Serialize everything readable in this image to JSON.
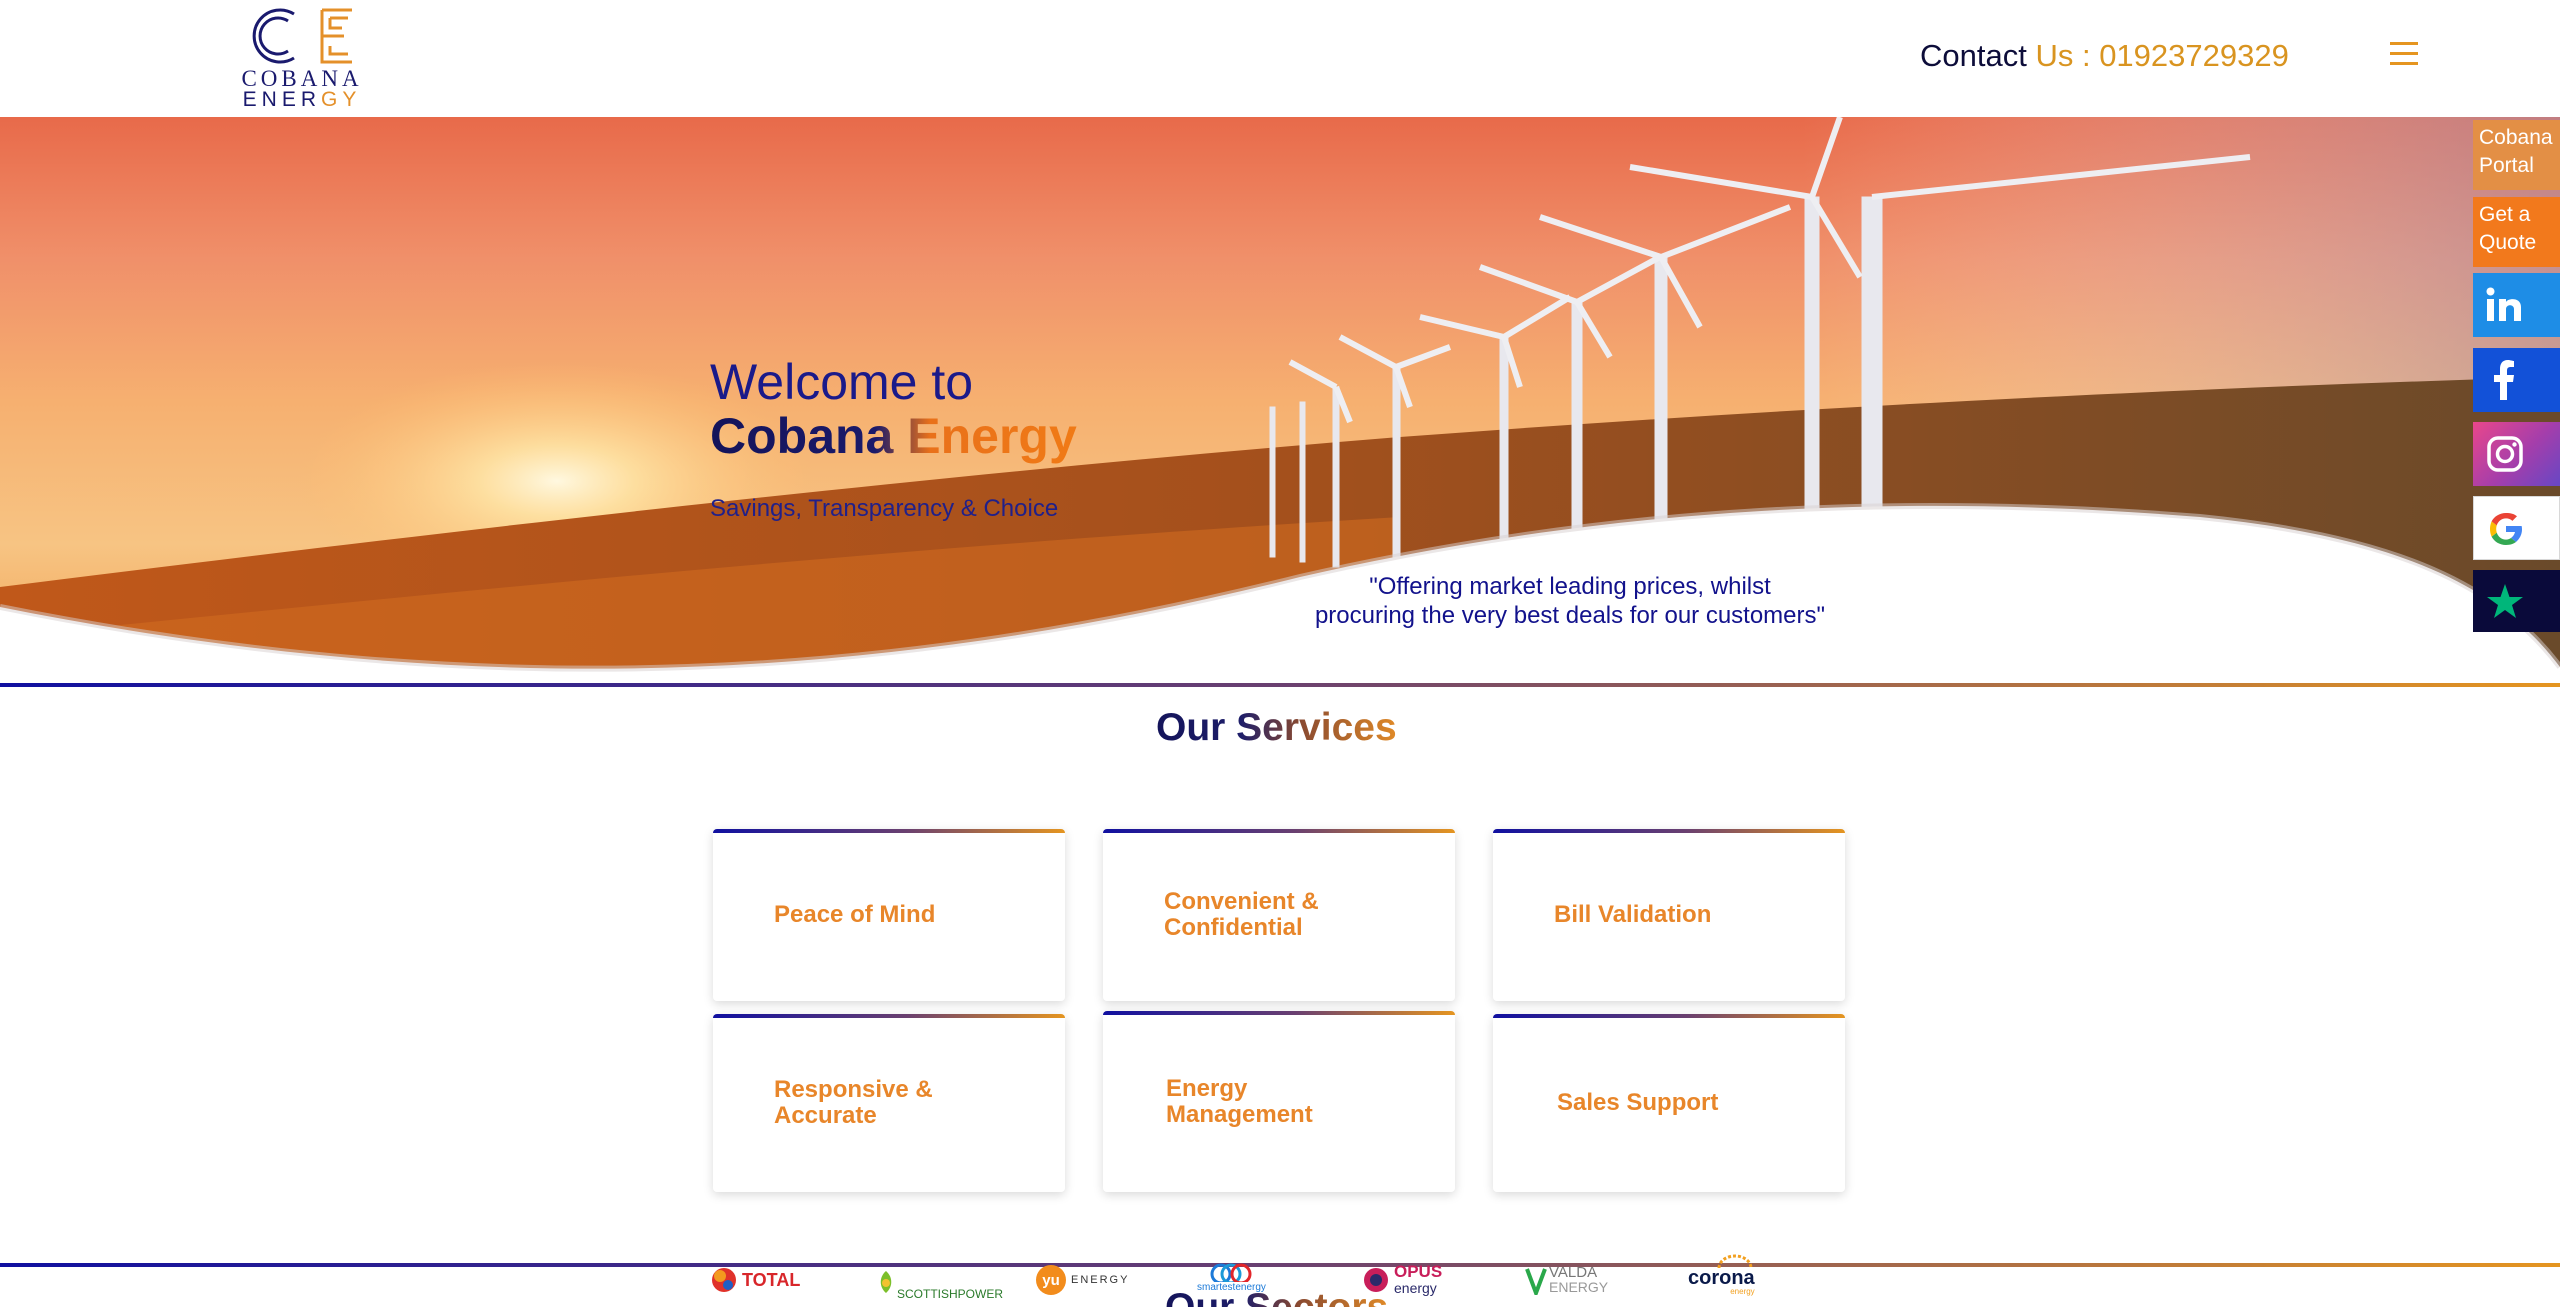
{
  "header": {
    "logo_line1": "COBANA",
    "logo_line2_a": "ENER",
    "logo_line2_b": "GY",
    "contact_label": "Contact",
    "contact_us": "Us : 01923729329",
    "menu_icon": "hamburger-icon"
  },
  "hero": {
    "title_line1": "Welcome to",
    "title_line2": "Cobana Energy",
    "tagline": "Savings, Transparency & Choice",
    "quote_line1": "\"Offering market leading prices, whilst",
    "quote_line2": "procuring the very best deals for our customers\""
  },
  "services": {
    "title": "Our Services",
    "items": [
      {
        "label": "Peace of Mind"
      },
      {
        "label": "Convenient & Confidential"
      },
      {
        "label": "Bill Validation"
      },
      {
        "label": "Responsive & Accurate"
      },
      {
        "label": "Energy Management"
      },
      {
        "label": "Sales Support"
      }
    ]
  },
  "side_buttons": {
    "portal_line1": "Cobana",
    "portal_line2": "Portal",
    "quote_line1": "Get a",
    "quote_line2": "Quote",
    "icons": [
      "linkedin-icon",
      "facebook-icon",
      "instagram-icon",
      "google-icon",
      "trustpilot-icon"
    ]
  },
  "suppliers": {
    "total": "TOTAL",
    "scottishpower": "SCOTTISHPOWER",
    "yu_badge": "yu",
    "yu_text": "ENERGY",
    "smartest": "smartestenergy",
    "opus_line1": "OPUS",
    "opus_line2": "energy",
    "valda_line1": "VALDA",
    "valda_line2": "ENERGY",
    "corona_line1": "corona",
    "corona_line2": "energy"
  },
  "sectors": {
    "title": "Our Sectors"
  },
  "colors": {
    "navy": "#14145a",
    "orange": "#e8862a",
    "gradient_start": "#1010a0",
    "gradient_end": "#e59520"
  }
}
